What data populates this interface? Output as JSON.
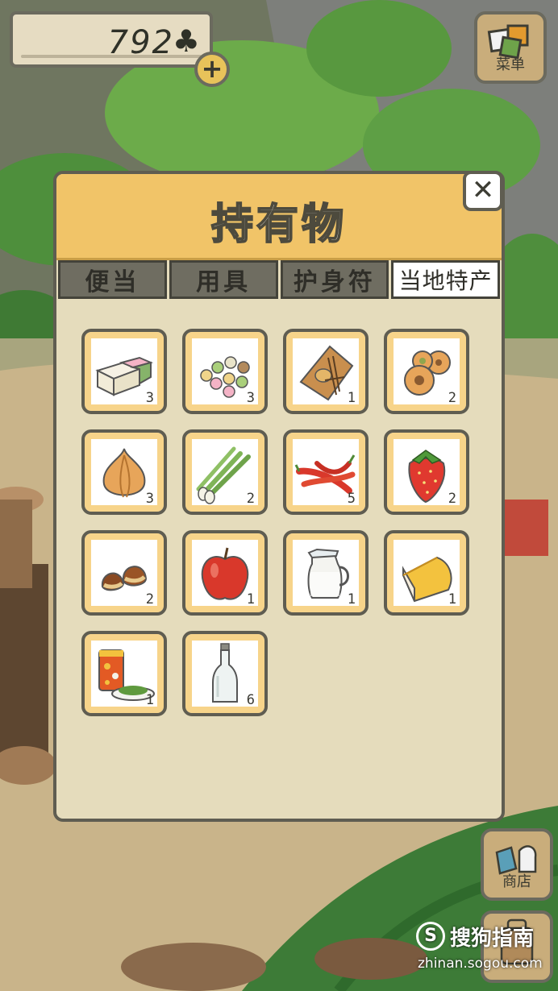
{
  "hud": {
    "clover_count": "792",
    "clover_icon": "♣",
    "add_label": "+"
  },
  "menu_button": {
    "label": "菜单"
  },
  "panel": {
    "title": "持有物",
    "close_label": "✕",
    "tabs": [
      {
        "label": "便当",
        "active": false
      },
      {
        "label": "用具",
        "active": false
      },
      {
        "label": "护身符",
        "active": false
      },
      {
        "label": "当地特产",
        "active": true
      }
    ],
    "items": [
      {
        "icon": "sweets-icon",
        "qty": "3"
      },
      {
        "icon": "dango-icon",
        "qty": "3"
      },
      {
        "icon": "senbei-icon",
        "qty": "1"
      },
      {
        "icon": "manju-icon",
        "qty": "2"
      },
      {
        "icon": "onion-icon",
        "qty": "3"
      },
      {
        "icon": "green-onion-icon",
        "qty": "2"
      },
      {
        "icon": "chili-icon",
        "qty": "5"
      },
      {
        "icon": "strawberry-icon",
        "qty": "2"
      },
      {
        "icon": "chestnut-icon",
        "qty": "2"
      },
      {
        "icon": "apple-icon",
        "qty": "1"
      },
      {
        "icon": "milk-icon",
        "qty": "1"
      },
      {
        "icon": "cheese-icon",
        "qty": "1"
      },
      {
        "icon": "tea-can-icon",
        "qty": "1"
      },
      {
        "icon": "bottle-icon",
        "qty": "6"
      }
    ]
  },
  "shop_button": {
    "label": "商店"
  },
  "watermark": {
    "brand": "搜狗指南",
    "url": "zhinan.sogou.com"
  },
  "colors": {
    "panel_bg": "#e5dcbc",
    "header": "#f1c468",
    "tab_inactive": "#6f6d61"
  }
}
